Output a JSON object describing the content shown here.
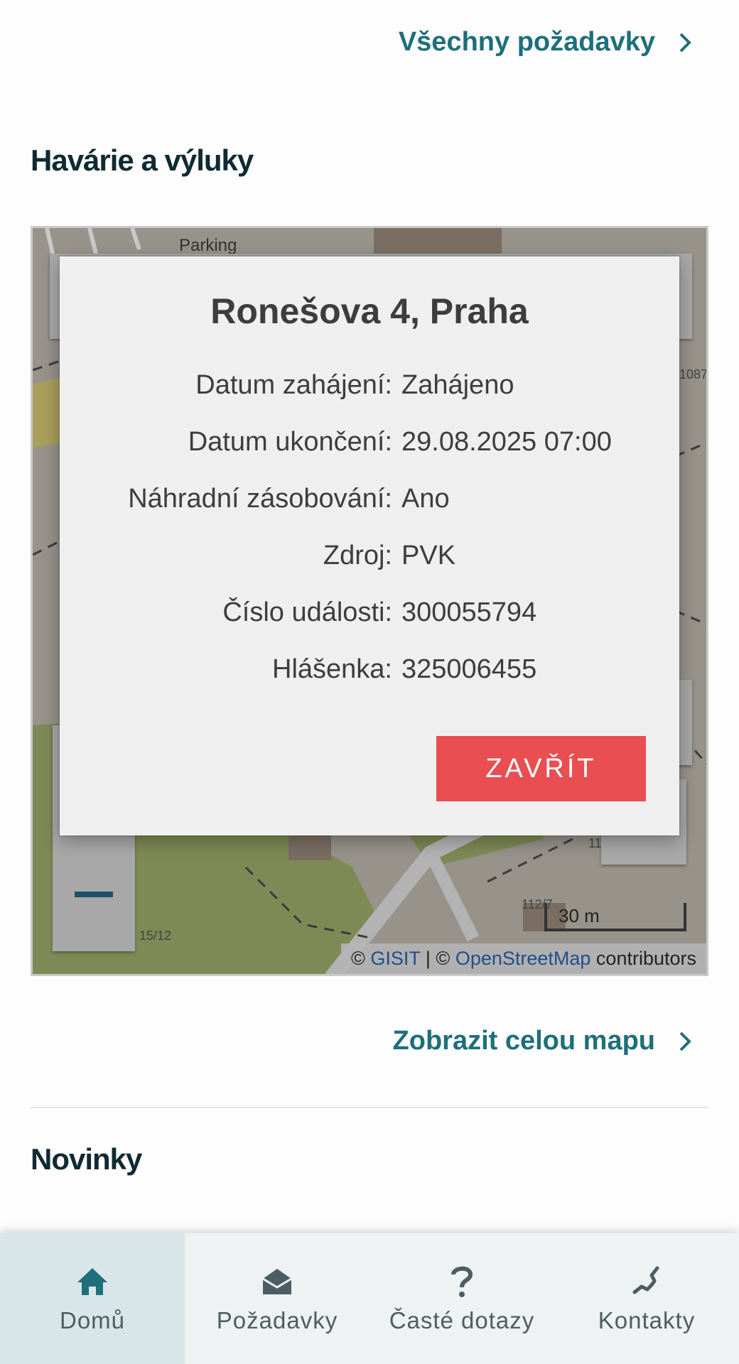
{
  "top_link": {
    "label": "Všechny požadavky"
  },
  "outages": {
    "title": "Havárie a výluky"
  },
  "map": {
    "street_label": "Parking",
    "numbers": [
      "1087",
      "15/12",
      "112/7",
      "11"
    ],
    "zoom_out_symbol": "−",
    "scale_label": "30 m",
    "attribution": {
      "prefix": "© ",
      "gisit": "GISIT",
      "mid": " | © ",
      "osm": "OpenStreetMap",
      "suffix": " contributors"
    }
  },
  "dialog": {
    "title": "Ronešova 4, Praha",
    "rows": [
      {
        "label": "Datum zahájení:",
        "value": "Zahájeno"
      },
      {
        "label": "Datum ukončení:",
        "value": "29.08.2025 07:00"
      },
      {
        "label": "Náhradní zásobování:",
        "value": "Ano"
      },
      {
        "label": "Zdroj:",
        "value": "PVK"
      },
      {
        "label": "Číslo události:",
        "value": "300055794"
      },
      {
        "label": "Hlášenka:",
        "value": "325006455"
      }
    ],
    "close_label": "ZAVŘÍT"
  },
  "map_link": {
    "label": "Zobrazit celou mapu"
  },
  "news": {
    "title": "Novinky"
  },
  "bottom_nav": {
    "items": [
      {
        "label": "Domů",
        "icon": "home-icon",
        "active": true
      },
      {
        "label": "Požadavky",
        "icon": "envelope-open-icon",
        "active": false
      },
      {
        "label": "Časté dotazy",
        "icon": "question-icon",
        "active": false
      },
      {
        "label": "Kontakty",
        "icon": "phone-icon",
        "active": false
      }
    ]
  },
  "colors": {
    "accent": "#1e6f7a",
    "close_button": "#e94e51",
    "nav_active_bg": "#d8e6e9",
    "nav_bg": "#eef2f3",
    "home_icon": "#1e6f7a",
    "dialog_bg": "#efefef"
  }
}
